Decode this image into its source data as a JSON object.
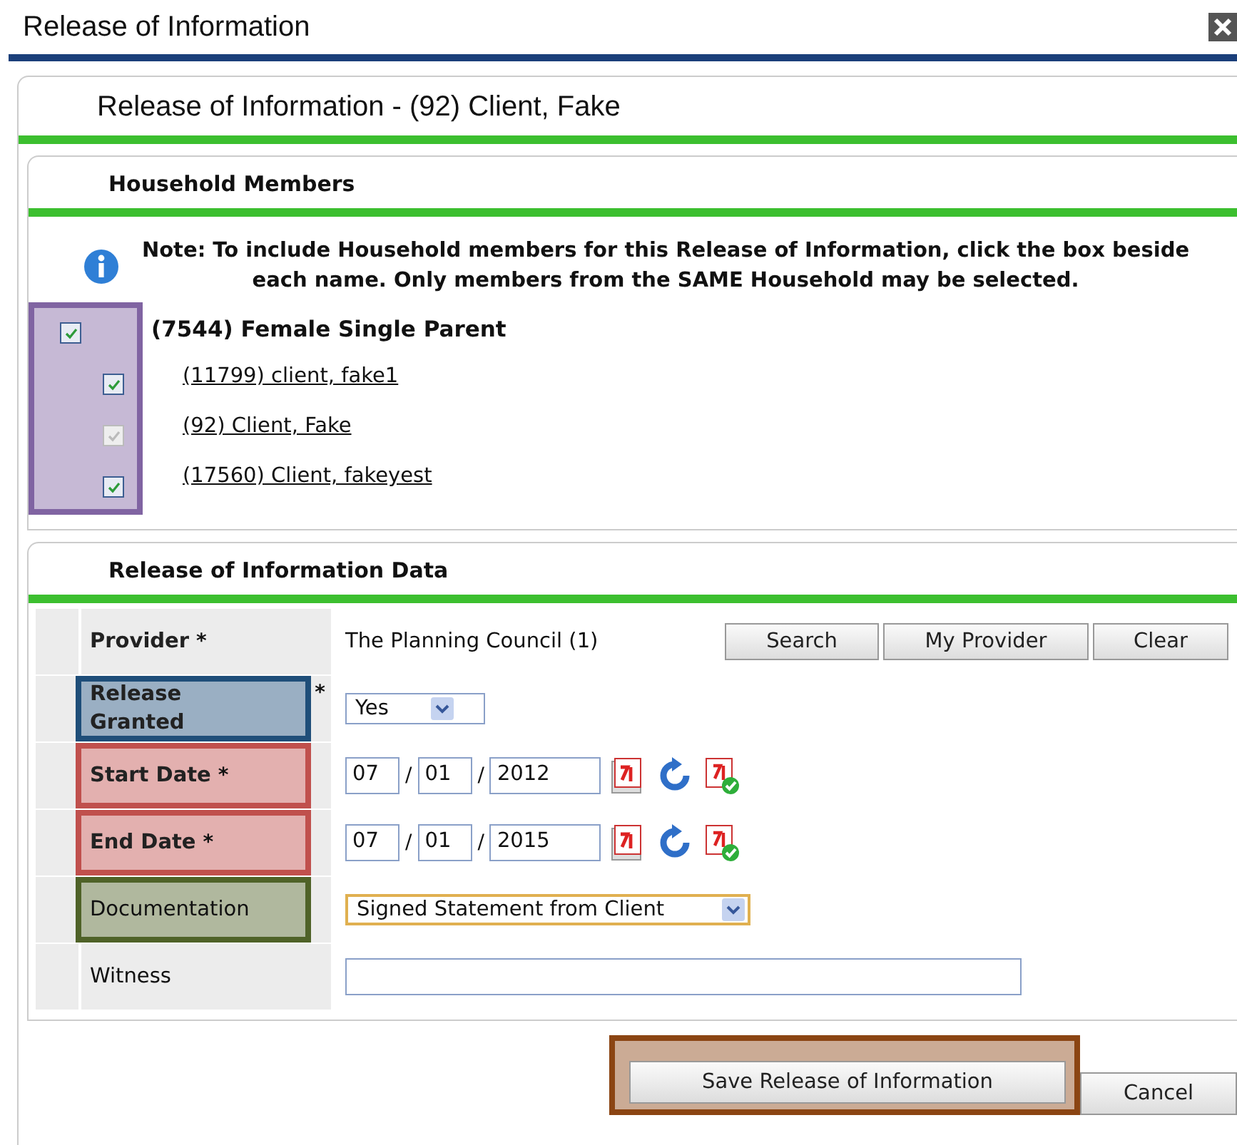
{
  "dialog": {
    "title": "Release of Information"
  },
  "header": {
    "title": "Release of Information - (92) Client, Fake"
  },
  "household": {
    "heading": "Household Members",
    "note": "Note: To include Household members for this Release of Information, click the box beside each name. Only members from the SAME Household may be selected.",
    "color": "#8064a2",
    "group": {
      "label": "(7544) Female Single Parent",
      "checked": true,
      "children": [
        {
          "label": "(11799) client, fake1",
          "checked": true,
          "disabled": false
        },
        {
          "label": "(92) Client, Fake",
          "checked": true,
          "disabled": true
        },
        {
          "label": "(17560) Client, fakeyest",
          "checked": true,
          "disabled": false
        }
      ]
    }
  },
  "data": {
    "heading": "Release of Information Data",
    "rows": [
      {
        "kind": "provider",
        "label": "Provider",
        "mark": "*",
        "value": "The Planning Council (1)",
        "buttons": [
          "Search",
          "My Provider",
          "Clear"
        ]
      },
      {
        "kind": "select",
        "label": "Release Granted",
        "mark": "*",
        "value": "Yes",
        "focused": false,
        "color": "#1f4e79"
      },
      {
        "kind": "date",
        "label": "Start Date",
        "mark": "*",
        "month": "07",
        "separator": "/",
        "day": "01",
        "year": "2012",
        "color": "#c0504d"
      },
      {
        "kind": "date",
        "label": "End Date",
        "mark": "*",
        "month": "07",
        "separator": "/",
        "day": "01",
        "year": "2015",
        "color": "#c0504d"
      },
      {
        "kind": "select",
        "label": "Documentation",
        "value": "Signed Statement from Client",
        "focused": true,
        "color": "#4f6228"
      },
      {
        "kind": "text",
        "label": "Witness"
      }
    ]
  },
  "actions": [
    {
      "label": "Save Release of Information",
      "color": "#8b4513"
    },
    {
      "label": "Cancel"
    }
  ]
}
